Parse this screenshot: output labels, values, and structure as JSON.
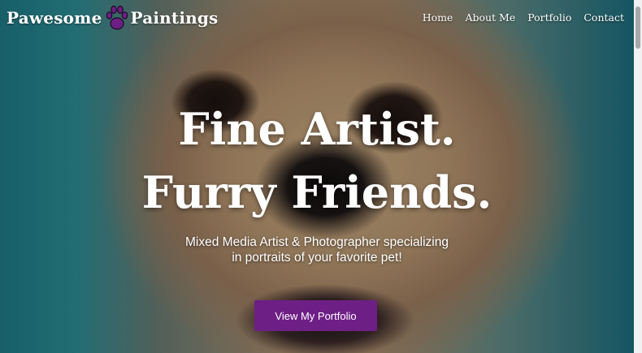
{
  "brand": {
    "name_left": "Pawesome",
    "name_right": "Paintings",
    "logo_icon": "paw-print-icon",
    "accent_color": "#6e1f86"
  },
  "nav": {
    "items": [
      {
        "label": "Home"
      },
      {
        "label": "About Me"
      },
      {
        "label": "Portfolio"
      },
      {
        "label": "Contact"
      }
    ]
  },
  "hero": {
    "headline_line1": "Fine Artist.",
    "headline_line2": "Furry Friends.",
    "subtitle_line1": "Mixed Media Artist & Photographer specializing",
    "subtitle_line2": "in portraits of your favorite pet!",
    "cta_label": "View My Portfolio",
    "background": "painted-dog-portrait"
  }
}
